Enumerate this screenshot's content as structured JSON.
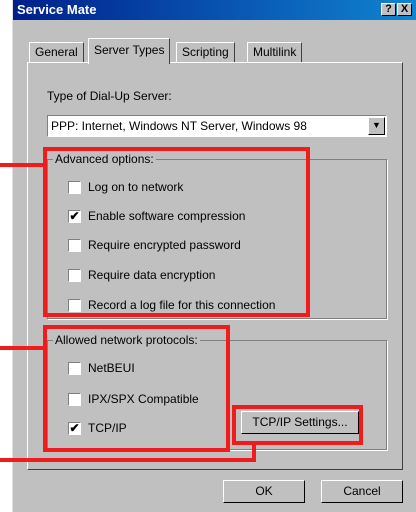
{
  "window": {
    "title": "Service Mate",
    "help_button": "?",
    "close_button": "X"
  },
  "tabs": [
    {
      "label": "General",
      "active": false
    },
    {
      "label": "Server Types",
      "active": true
    },
    {
      "label": "Scripting",
      "active": false
    },
    {
      "label": "Multilink",
      "active": false
    }
  ],
  "server_type": {
    "label": "Type of Dial-Up Server:",
    "selected": "PPP: Internet, Windows NT Server, Windows 98",
    "arrow_icon": "chevron-down-icon"
  },
  "advanced_options": {
    "title": "Advanced options:",
    "items": [
      {
        "label": "Log on to network",
        "checked": false,
        "mark": ""
      },
      {
        "label": "Enable software compression",
        "checked": true,
        "mark": "✔"
      },
      {
        "label": "Require encrypted password",
        "checked": false,
        "mark": ""
      },
      {
        "label": "Require data encryption",
        "checked": false,
        "mark": ""
      },
      {
        "label": "Record a log file for this connection",
        "checked": false,
        "mark": ""
      }
    ]
  },
  "protocols": {
    "title": "Allowed network protocols:",
    "items": [
      {
        "label": "NetBEUI",
        "checked": false,
        "mark": ""
      },
      {
        "label": "IPX/SPX Compatible",
        "checked": false,
        "mark": ""
      },
      {
        "label": "TCP/IP",
        "checked": true,
        "mark": "✔"
      }
    ],
    "settings_button": "TCP/IP Settings..."
  },
  "footer": {
    "ok_label": "OK",
    "cancel_label": "Cancel"
  },
  "highlight_color": "#ee1c1c"
}
